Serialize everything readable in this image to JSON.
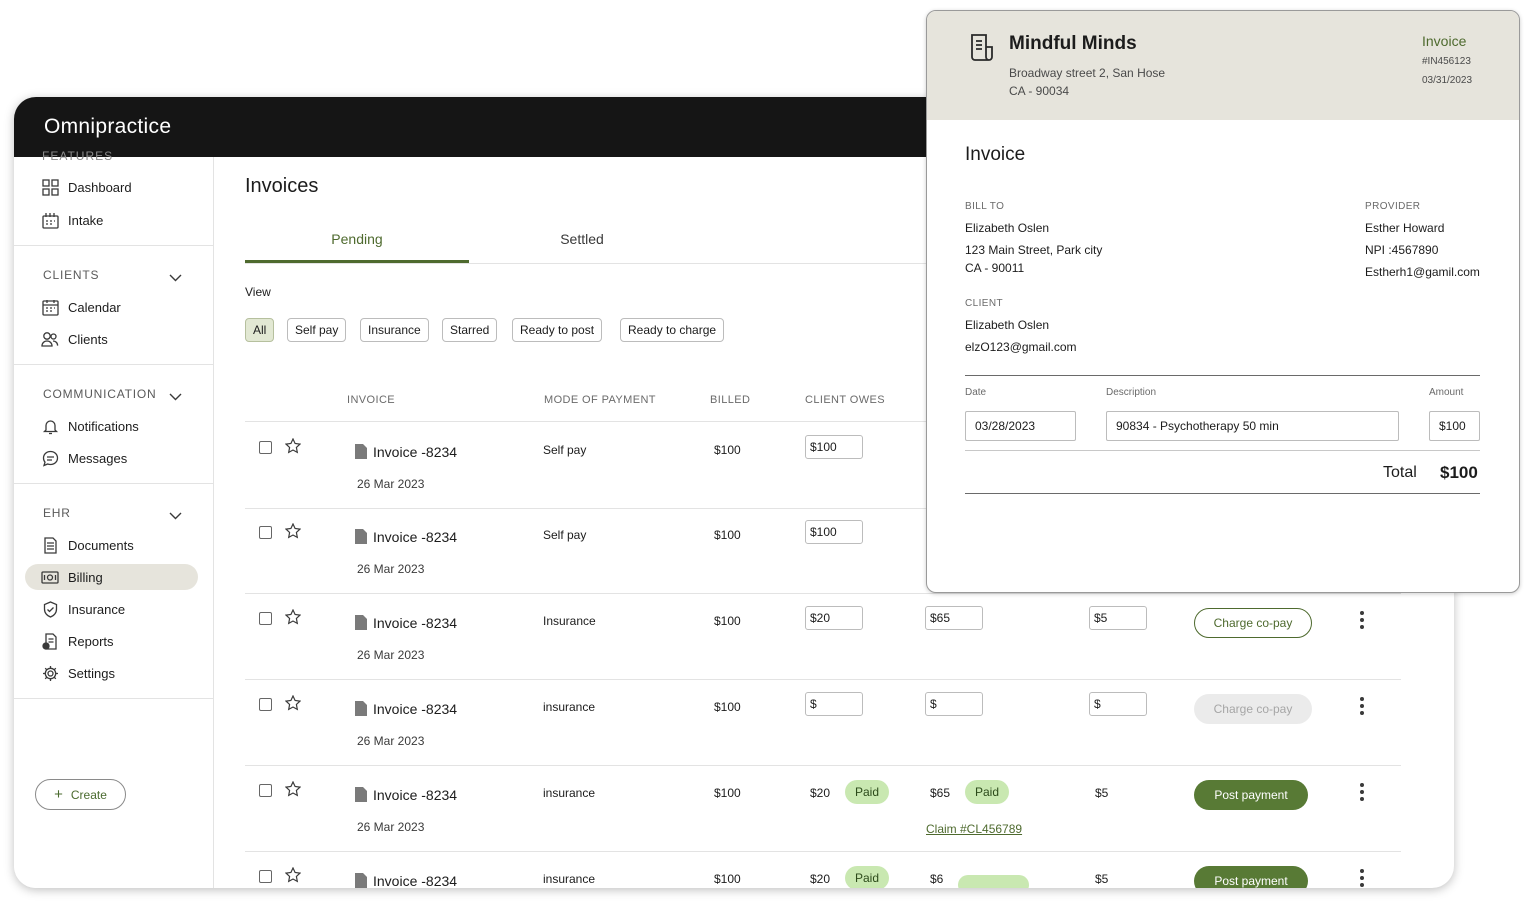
{
  "app": {
    "logo": "Omnipractice"
  },
  "sidebar": {
    "cut_section": "FEATURES",
    "top_items": [
      {
        "label": "Dashboard",
        "icon": "grid-icon"
      },
      {
        "label": "Intake",
        "icon": "intake-icon"
      }
    ],
    "clients": {
      "title": "CLIENTS",
      "items": [
        {
          "label": "Calendar",
          "icon": "calendar-icon"
        },
        {
          "label": "Clients",
          "icon": "users-icon"
        }
      ]
    },
    "communication": {
      "title": "COMMUNICATION",
      "items": [
        {
          "label": "Notifications",
          "icon": "bell-icon"
        },
        {
          "label": "Messages",
          "icon": "chat-icon"
        }
      ]
    },
    "ehr": {
      "title": "EHR",
      "items": [
        {
          "label": "Documents",
          "icon": "document-icon"
        },
        {
          "label": "Billing",
          "icon": "billing-icon",
          "active": true
        },
        {
          "label": "Insurance",
          "icon": "shield-icon"
        },
        {
          "label": "Reports",
          "icon": "report-icon"
        },
        {
          "label": "Settings",
          "icon": "gear-icon"
        }
      ]
    },
    "create_label": "Create"
  },
  "main": {
    "title": "Invoices",
    "tabs": [
      {
        "label": "Pending",
        "active": true
      },
      {
        "label": "Settled"
      }
    ],
    "view_label": "View",
    "filters": [
      "All",
      "Self pay",
      "Insurance",
      "Starred",
      "Ready to post",
      "Ready to charge"
    ],
    "selected_filter": "All",
    "columns": [
      "INVOICE",
      "MODE OF PAYMENT",
      "BILLED",
      "CLIENT OWES"
    ],
    "rows": [
      {
        "invoice": "Invoice -8234",
        "date": "26 Mar 2023",
        "mode": "Self pay",
        "billed": "$100",
        "client_owes": "$100"
      },
      {
        "invoice": "Invoice -8234",
        "date": "26 Mar 2023",
        "mode": "Self pay",
        "billed": "$100",
        "client_owes": "$100"
      },
      {
        "invoice": "Invoice -8234",
        "date": "26 Mar 2023",
        "mode": "Insurance",
        "billed": "$100",
        "client_owes": "$20",
        "insurance_owes": "$65",
        "copay": "$5",
        "action": "Charge co-pay"
      },
      {
        "invoice": "Invoice -8234",
        "date": "26 Mar 2023",
        "mode": "insurance",
        "billed": "$100",
        "client_owes": "$",
        "insurance_owes": "$",
        "copay": "$",
        "action": "Charge co-pay"
      },
      {
        "invoice": "Invoice -8234",
        "date": "26 Mar 2023",
        "mode": "insurance",
        "billed": "$100",
        "client_owes": "$20",
        "client_status": "Paid",
        "insurance_owes": "$65",
        "insurance_status": "Paid",
        "claim": "Claim #CL456789",
        "copay": "$5",
        "action": "Post payment"
      },
      {
        "invoice": "Invoice -8234",
        "mode": "insurance",
        "billed": "$100",
        "client_owes": "$20",
        "client_status": "Paid",
        "insurance_owes": "$6",
        "copay": "$5",
        "action": "Post payment"
      }
    ]
  },
  "invoice_panel": {
    "org_name": "Mindful Minds",
    "org_address_1": "Broadway street 2, San Hose",
    "org_address_2": "CA - 90034",
    "header_label": "Invoice",
    "number": "#IN456123",
    "date": "03/31/2023",
    "title": "Invoice",
    "bill_to_label": "BILL TO",
    "bill_to": {
      "name": "Elizabeth Oslen",
      "address_1": "123 Main Street, Park city",
      "address_2": "CA -  90011"
    },
    "provider_label": "PROVIDER",
    "provider": {
      "name": "Esther Howard",
      "npi": "NPI :4567890",
      "email": "Estherh1@gamil.com"
    },
    "client_label": "CLIENT",
    "client": {
      "name": "Elizabeth Oslen",
      "email": "elzO123@gmail.com"
    },
    "line_headers": {
      "date": "Date",
      "description": "Description",
      "amount": "Amount"
    },
    "line_item": {
      "date": "03/28/2023",
      "description": "90834 - Psychotherapy 50 min",
      "amount": "$100"
    },
    "total_label": "Total",
    "total_value": "$100"
  }
}
